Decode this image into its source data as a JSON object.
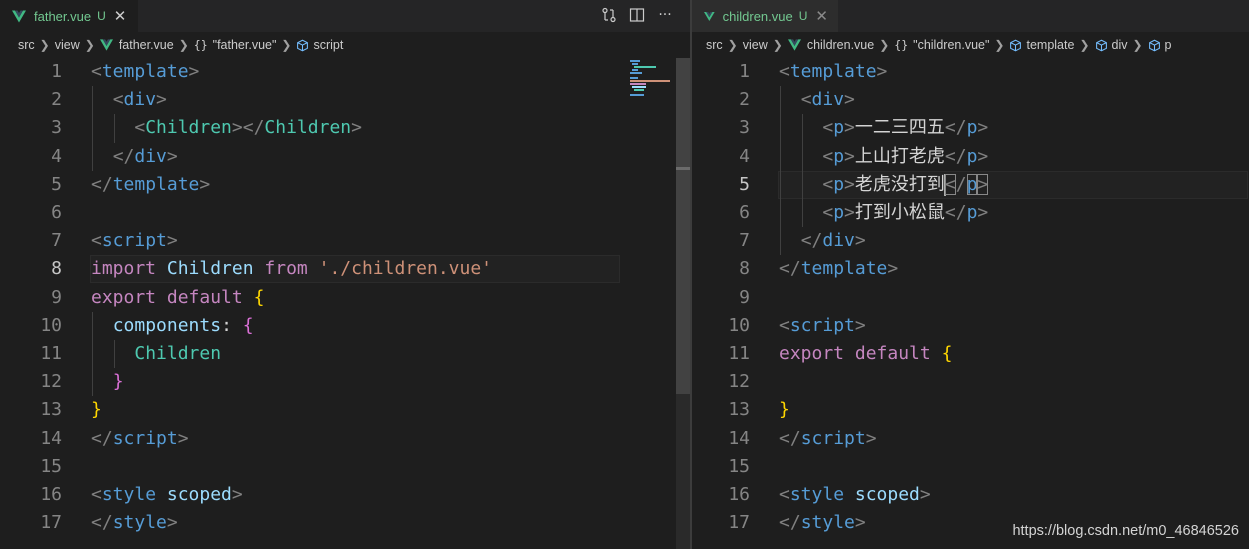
{
  "left": {
    "tab": {
      "name": "father.vue",
      "badge": "U",
      "close": "✕"
    },
    "actions": [
      "open-changes",
      "split-editor",
      "more-actions"
    ],
    "more_actions_label": "···",
    "breadcrumb": {
      "folder1": "src",
      "folder2": "view",
      "file": "father.vue",
      "component": "\"father.vue\"",
      "braces": "{}",
      "symbol": "script"
    },
    "lines": [
      {
        "n": "1",
        "tokens": [
          [
            "br",
            "<"
          ],
          [
            "tag",
            "template"
          ],
          [
            "br",
            ">"
          ]
        ]
      },
      {
        "n": "2",
        "tokens": [
          [
            "plain",
            "  "
          ],
          [
            "br",
            "<"
          ],
          [
            "tag",
            "div"
          ],
          [
            "br",
            ">"
          ]
        ]
      },
      {
        "n": "3",
        "tokens": [
          [
            "plain",
            "    "
          ],
          [
            "br",
            "<"
          ],
          [
            "comp",
            "Children"
          ],
          [
            "br",
            "></"
          ],
          [
            "comp",
            "Children"
          ],
          [
            "br",
            ">"
          ]
        ]
      },
      {
        "n": "4",
        "tokens": [
          [
            "plain",
            "  "
          ],
          [
            "br",
            "</"
          ],
          [
            "tag",
            "div"
          ],
          [
            "br",
            ">"
          ]
        ]
      },
      {
        "n": "5",
        "tokens": [
          [
            "br",
            "</"
          ],
          [
            "tag",
            "template"
          ],
          [
            "br",
            ">"
          ]
        ]
      },
      {
        "n": "6",
        "tokens": []
      },
      {
        "n": "7",
        "tokens": [
          [
            "br",
            "<"
          ],
          [
            "tag",
            "script"
          ],
          [
            "br",
            ">"
          ]
        ]
      },
      {
        "n": "8",
        "tokens": [
          [
            "kw",
            "import"
          ],
          [
            "plain",
            " "
          ],
          [
            "id",
            "Children"
          ],
          [
            "plain",
            " "
          ],
          [
            "kw",
            "from"
          ],
          [
            "plain",
            " "
          ],
          [
            "str",
            "'./children.vue'"
          ]
        ]
      },
      {
        "n": "9",
        "tokens": [
          [
            "kw",
            "export"
          ],
          [
            "plain",
            " "
          ],
          [
            "kw",
            "default"
          ],
          [
            "plain",
            " "
          ],
          [
            "y",
            "{"
          ]
        ]
      },
      {
        "n": "10",
        "tokens": [
          [
            "plain",
            "  "
          ],
          [
            "id",
            "components"
          ],
          [
            "plain",
            ": "
          ],
          [
            "p",
            "{"
          ]
        ]
      },
      {
        "n": "11",
        "tokens": [
          [
            "plain",
            "    "
          ],
          [
            "comp",
            "Children"
          ]
        ]
      },
      {
        "n": "12",
        "tokens": [
          [
            "plain",
            "  "
          ],
          [
            "p",
            "}"
          ]
        ]
      },
      {
        "n": "13",
        "tokens": [
          [
            "y",
            "}"
          ]
        ]
      },
      {
        "n": "14",
        "tokens": [
          [
            "br",
            "</"
          ],
          [
            "tag",
            "script"
          ],
          [
            "br",
            ">"
          ]
        ]
      },
      {
        "n": "15",
        "tokens": []
      },
      {
        "n": "16",
        "tokens": [
          [
            "br",
            "<"
          ],
          [
            "tag",
            "style"
          ],
          [
            "plain",
            " "
          ],
          [
            "id",
            "scoped"
          ],
          [
            "br",
            ">"
          ]
        ]
      },
      {
        "n": "17",
        "tokens": [
          [
            "br",
            "</"
          ],
          [
            "tag",
            "style"
          ],
          [
            "br",
            ">"
          ]
        ]
      }
    ],
    "active_line": 8
  },
  "right": {
    "tab": {
      "name": "children.vue",
      "badge": "U",
      "close": "✕"
    },
    "breadcrumb": {
      "folder1": "src",
      "folder2": "view",
      "file": "children.vue",
      "component": "\"children.vue\"",
      "braces": "{}",
      "symbol1": "template",
      "symbol2": "div",
      "symbol3": "p"
    },
    "lines": [
      {
        "n": "1",
        "tokens": [
          [
            "br",
            "<"
          ],
          [
            "tag",
            "template"
          ],
          [
            "br",
            ">"
          ]
        ]
      },
      {
        "n": "2",
        "tokens": [
          [
            "plain",
            "  "
          ],
          [
            "br",
            "<"
          ],
          [
            "tag",
            "div"
          ],
          [
            "br",
            ">"
          ]
        ]
      },
      {
        "n": "3",
        "tokens": [
          [
            "plain",
            "    "
          ],
          [
            "br",
            "<"
          ],
          [
            "tag",
            "p"
          ],
          [
            "br",
            ">"
          ],
          [
            "plain",
            "一二三四五"
          ],
          [
            "br",
            "</"
          ],
          [
            "tag",
            "p"
          ],
          [
            "br",
            ">"
          ]
        ]
      },
      {
        "n": "4",
        "tokens": [
          [
            "plain",
            "    "
          ],
          [
            "br",
            "<"
          ],
          [
            "tag",
            "p"
          ],
          [
            "br",
            ">"
          ],
          [
            "plain",
            "上山打老虎"
          ],
          [
            "br",
            "</"
          ],
          [
            "tag",
            "p"
          ],
          [
            "br",
            ">"
          ]
        ]
      },
      {
        "n": "5",
        "tokens": [
          [
            "plain",
            "    "
          ],
          [
            "br",
            "<"
          ],
          [
            "tag",
            "p"
          ],
          [
            "br",
            ">"
          ],
          [
            "plain",
            "老虎没打到"
          ],
          [
            "cursor",
            ""
          ],
          [
            "brm",
            "<"
          ],
          [
            "br",
            "/"
          ],
          [
            "tagm",
            "p"
          ],
          [
            "brm",
            ">"
          ]
        ]
      },
      {
        "n": "6",
        "tokens": [
          [
            "plain",
            "    "
          ],
          [
            "br",
            "<"
          ],
          [
            "tag",
            "p"
          ],
          [
            "br",
            ">"
          ],
          [
            "plain",
            "打到小松鼠"
          ],
          [
            "br",
            "</"
          ],
          [
            "tag",
            "p"
          ],
          [
            "br",
            ">"
          ]
        ]
      },
      {
        "n": "7",
        "tokens": [
          [
            "plain",
            "  "
          ],
          [
            "br",
            "</"
          ],
          [
            "tag",
            "div"
          ],
          [
            "br",
            ">"
          ]
        ]
      },
      {
        "n": "8",
        "tokens": [
          [
            "br",
            "</"
          ],
          [
            "tag",
            "template"
          ],
          [
            "br",
            ">"
          ]
        ]
      },
      {
        "n": "9",
        "tokens": []
      },
      {
        "n": "10",
        "tokens": [
          [
            "br",
            "<"
          ],
          [
            "tag",
            "script"
          ],
          [
            "br",
            ">"
          ]
        ]
      },
      {
        "n": "11",
        "tokens": [
          [
            "kw",
            "export"
          ],
          [
            "plain",
            " "
          ],
          [
            "kw",
            "default"
          ],
          [
            "plain",
            " "
          ],
          [
            "y",
            "{"
          ]
        ]
      },
      {
        "n": "12",
        "tokens": []
      },
      {
        "n": "13",
        "tokens": [
          [
            "y",
            "}"
          ]
        ]
      },
      {
        "n": "14",
        "tokens": [
          [
            "br",
            "</"
          ],
          [
            "tag",
            "script"
          ],
          [
            "br",
            ">"
          ]
        ]
      },
      {
        "n": "15",
        "tokens": []
      },
      {
        "n": "16",
        "tokens": [
          [
            "br",
            "<"
          ],
          [
            "tag",
            "style"
          ],
          [
            "plain",
            " "
          ],
          [
            "id",
            "scoped"
          ],
          [
            "br",
            ">"
          ]
        ]
      },
      {
        "n": "17",
        "tokens": [
          [
            "br",
            "</"
          ],
          [
            "tag",
            "style"
          ],
          [
            "br",
            ">"
          ]
        ]
      }
    ],
    "active_line": 5
  },
  "watermark": "https://blog.csdn.net/m0_46846526",
  "colors": {
    "vue_green": "#41b883",
    "untracked": "#73c991",
    "tag": "#569cd6",
    "component": "#4ec9b0",
    "keyword": "#c586c0",
    "string": "#ce9178",
    "identifier": "#9cdcfe"
  }
}
